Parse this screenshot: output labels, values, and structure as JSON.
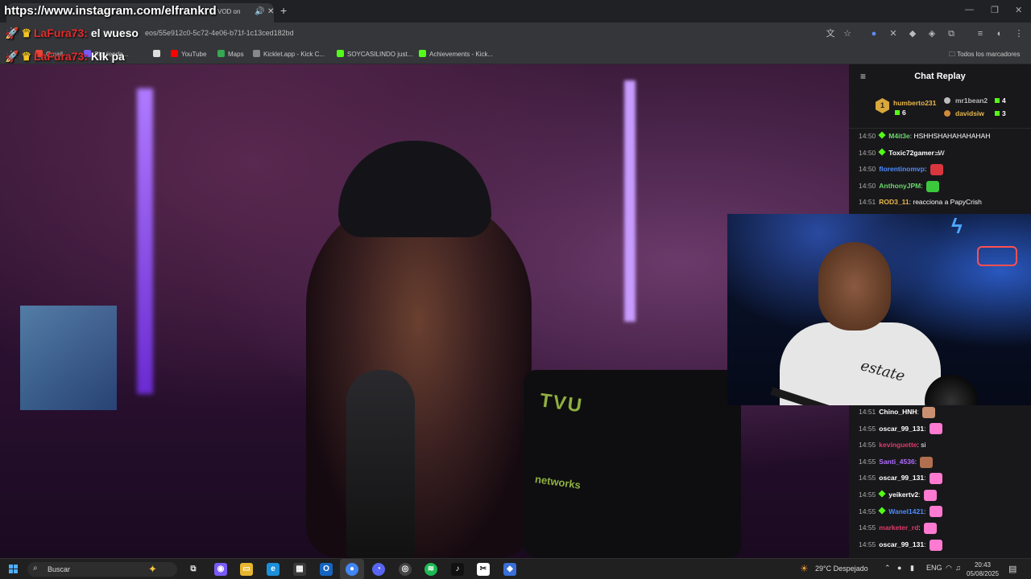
{
  "overlay": {
    "url": "https://www.instagram.com/elfrankrd",
    "line1_user": "LaFura73:",
    "line1_text": "el wueso",
    "line2_user": "LaFura73:",
    "line2_text": "Klk pa"
  },
  "browser": {
    "tab_title": "VOD on",
    "url": "eos/55e912c0-5c72-4e06-b71f-1c13ced182bd",
    "bookmarks": [
      {
        "label": "Gmail",
        "color": "#ea4335"
      },
      {
        "label": "Siguiendo...",
        "color": "#7a5af8"
      },
      {
        "label": "",
        "color": "#dddddd"
      },
      {
        "label": "YouTube",
        "color": "#ff0000"
      },
      {
        "label": "Maps",
        "color": "#34a853"
      },
      {
        "label": "Kicklet.app - Kick C...",
        "color": "#888888"
      },
      {
        "label": "SOYCASILINDO just...",
        "color": "#53fc18"
      },
      {
        "label": "Achievements - Kick...",
        "color": "#53fc18"
      }
    ],
    "all_bookmarks": "Todos los marcadores"
  },
  "video": {
    "bag_text": "TVU",
    "bag_sub": "networks"
  },
  "webcam": {
    "shirt_text": "estate"
  },
  "chat": {
    "title": "Chat Replay",
    "leaderboard": {
      "first": {
        "rank": "1",
        "name": "humberto231",
        "count": "6"
      },
      "second": {
        "name": "mr1bean2",
        "count": "4"
      },
      "third": {
        "name": "davidsiw",
        "count": "3"
      }
    },
    "messages_top": [
      {
        "time": "14:50",
        "user": "M4it3e",
        "text": "HSHHSHAHAHAHAHAH",
        "color": "#6bd86b",
        "badge": true,
        "emote": ""
      },
      {
        "time": "14:50",
        "user": "Toxic72gamer",
        "text": "W",
        "color": "#ffffff",
        "badge": true,
        "emote": ""
      },
      {
        "time": "14:50",
        "user": "florentinomvp",
        "text": "",
        "color": "#4f8cff",
        "badge": false,
        "emote": "#d9363e"
      },
      {
        "time": "14:50",
        "user": "AnthonyJPM",
        "text": "",
        "color": "#6bd86b",
        "badge": false,
        "emote": "#3cc83c"
      },
      {
        "time": "14:51",
        "user": "ROD3_11",
        "text": "reacciona a PapyCrish",
        "color": "#e8b84a",
        "badge": false,
        "emote": ""
      }
    ],
    "messages_bottom": [
      {
        "time": "14:51",
        "user": "Chino_HNH",
        "text": "",
        "color": "#ffffff",
        "badge": false,
        "emote": "#c89070"
      },
      {
        "time": "14:55",
        "user": "oscar_99_131",
        "text": "",
        "color": "#ffffff",
        "badge": false,
        "emote": "#ff7ad0"
      },
      {
        "time": "14:55",
        "user": "kevinguette",
        "text": "si",
        "color": "#e03a6a",
        "badge": false,
        "emote": ""
      },
      {
        "time": "14:55",
        "user": "Santi_4536",
        "text": "",
        "color": "#b06cff",
        "badge": false,
        "emote": "#b07050"
      },
      {
        "time": "14:55",
        "user": "oscar_99_131",
        "text": "",
        "color": "#ffffff",
        "badge": false,
        "emote": "#ff7ad0"
      },
      {
        "time": "14:55",
        "user": "yeikertv2",
        "text": "",
        "color": "#ffffff",
        "badge": true,
        "emote": "#ff7ad0"
      },
      {
        "time": "14:55",
        "user": "Wanel1421",
        "text": "",
        "color": "#4f8cff",
        "badge": true,
        "emote": "#ff7ad0"
      },
      {
        "time": "14:55",
        "user": "marketer_rd",
        "text": "",
        "color": "#e03a6a",
        "badge": false,
        "emote": "#ff7ad0"
      },
      {
        "time": "14:55",
        "user": "oscar_99_131",
        "text": "",
        "color": "#ffffff",
        "badge": false,
        "emote": "#ff7ad0"
      }
    ]
  },
  "taskbar": {
    "search_placeholder": "Buscar",
    "weather": "29°C  Despejado",
    "lang": "ENG",
    "time": "20:43",
    "date": "05/08/2025"
  }
}
